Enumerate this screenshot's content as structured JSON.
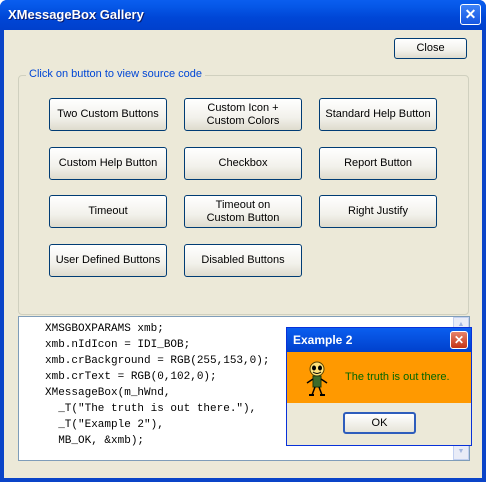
{
  "window": {
    "title": "XMessageBox Gallery",
    "close_symbol": "✕"
  },
  "close_button": "Close",
  "group_label": "Click on button to view source code",
  "buttons": [
    "Two Custom Buttons",
    "Custom Icon +\nCustom Colors",
    "Standard Help Button",
    "Custom Help Button",
    "Checkbox",
    "Report Button",
    "Timeout",
    "Timeout on\nCustom Button",
    "Right Justify",
    "User Defined Buttons",
    "Disabled Buttons"
  ],
  "code_lines": [
    "XMSGBOXPARAMS xmb;",
    "xmb.nIdIcon = IDI_BOB;",
    "xmb.crBackground = RGB(255,153,0);",
    "xmb.crText = RGB(0,102,0);",
    "XMessageBox(m_hWnd,",
    "  _T(\"The truth is out there.\"),",
    "  _T(\"Example 2\"),",
    "  MB_OK, &xmb);"
  ],
  "dialog": {
    "title": "Example 2",
    "close_symbol": "✕",
    "message": "The truth is out there.",
    "ok_label": "OK",
    "background_color": "#ff9900",
    "text_color": "#006600",
    "icon": "bob-icon"
  },
  "scrollbar": {
    "up_symbol": "▲",
    "down_symbol": "▼"
  }
}
